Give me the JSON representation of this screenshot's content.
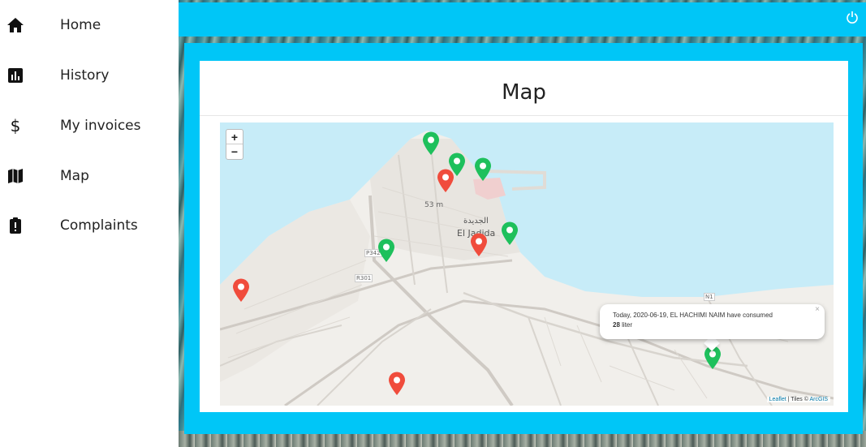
{
  "sidebar": {
    "items": [
      {
        "label": "Home",
        "icon": "home-icon"
      },
      {
        "label": "History",
        "icon": "bar-chart-icon"
      },
      {
        "label": "My invoices",
        "icon": "dollar-icon"
      },
      {
        "label": "Map",
        "icon": "map-icon"
      },
      {
        "label": "Complaints",
        "icon": "clipboard-alert-icon"
      }
    ]
  },
  "topbar": {
    "power_icon": "power-icon",
    "color": "#00c6f7"
  },
  "card": {
    "title": "Map"
  },
  "map": {
    "zoom_in": "+",
    "zoom_out": "−",
    "city_name_ar": "الجديدة",
    "city_name": "El Jadida",
    "road_labels": [
      "P342",
      "R301",
      "N1"
    ],
    "elevation_label": "53 m",
    "markers": [
      {
        "status": "ok"
      },
      {
        "status": "ok"
      },
      {
        "status": "ok"
      },
      {
        "status": "ok"
      },
      {
        "status": "ok"
      },
      {
        "status": "ok"
      },
      {
        "status": "alert"
      },
      {
        "status": "alert"
      },
      {
        "status": "alert"
      },
      {
        "status": "alert"
      }
    ],
    "marker_colors": {
      "ok": "#1ec05c",
      "alert": "#f04c3c"
    },
    "popup": {
      "text": "Today, 2020-06-19, EL HACHIMI NAIM have consumed",
      "value": "28",
      "unit": "liter",
      "close": "×"
    },
    "attribution": {
      "leaflet": "Leaflet",
      "separator": " | Tiles © ",
      "tiles": "ArcGIS"
    }
  }
}
